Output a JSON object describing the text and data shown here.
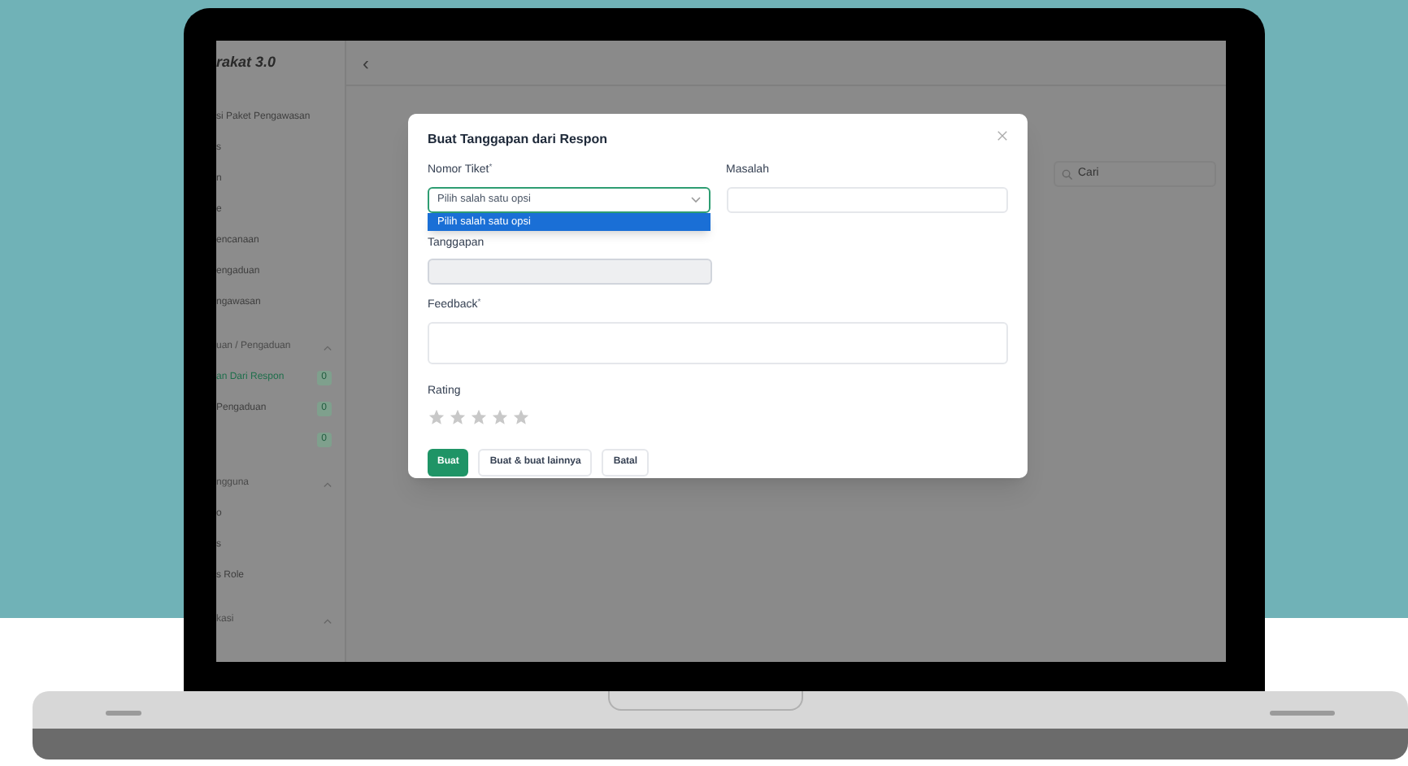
{
  "app": {
    "brand": "rakat 3.0",
    "collapse_icon": "‹"
  },
  "sidebar": {
    "items": [
      {
        "kind": "item",
        "label": "si Paket Pengawasan",
        "selected": false
      },
      {
        "kind": "item",
        "label": "s",
        "selected": false
      },
      {
        "kind": "item",
        "label": "n",
        "selected": false
      },
      {
        "kind": "item",
        "label": "e",
        "selected": false
      },
      {
        "kind": "item",
        "label": "encanaan",
        "selected": false
      },
      {
        "kind": "item",
        "label": "engaduan",
        "selected": false
      },
      {
        "kind": "item",
        "label": "ngawasan",
        "selected": false
      },
      {
        "kind": "group",
        "label": "uan / Pengaduan",
        "expanded": true
      },
      {
        "kind": "item",
        "label": "an Dari Respon",
        "badge": "0",
        "selected": true
      },
      {
        "kind": "item",
        "label": "Pengaduan",
        "badge": "0",
        "selected": false
      },
      {
        "kind": "item",
        "badge": "0",
        "selected": false
      },
      {
        "kind": "group",
        "label": "ngguna",
        "expanded": true
      },
      {
        "kind": "item",
        "label": "o",
        "selected": false
      },
      {
        "kind": "item",
        "label": "s",
        "selected": false
      },
      {
        "kind": "item",
        "label": "s Role",
        "selected": false
      },
      {
        "kind": "group",
        "label": "kasi",
        "expanded": true
      }
    ]
  },
  "page": {
    "search": {
      "placeholder": "Cari"
    }
  },
  "modal": {
    "title": "Buat Tanggapan dari Respon",
    "fields": [
      {
        "label": "Nomor Tiket",
        "required_mark": "*",
        "kind": "select",
        "placeholder": "Pilih salah satu opsi",
        "focused": true,
        "options": [
          {
            "label": "Pilih salah satu opsi",
            "selected": true
          }
        ]
      },
      {
        "label": "Masalah",
        "kind": "input"
      },
      {
        "label": "Tanggapan",
        "kind": "input",
        "disabled": true
      },
      {
        "label": "Feedback",
        "required_mark": "*",
        "kind": "textarea"
      }
    ],
    "rating": {
      "label": "Rating",
      "stars": 0
    },
    "buttons": [
      {
        "label": "Buat",
        "kind": "primary"
      },
      {
        "label": "Buat & buat lainnya",
        "kind": "secondary"
      },
      {
        "label": "Batal",
        "kind": "secondary"
      }
    ]
  }
}
